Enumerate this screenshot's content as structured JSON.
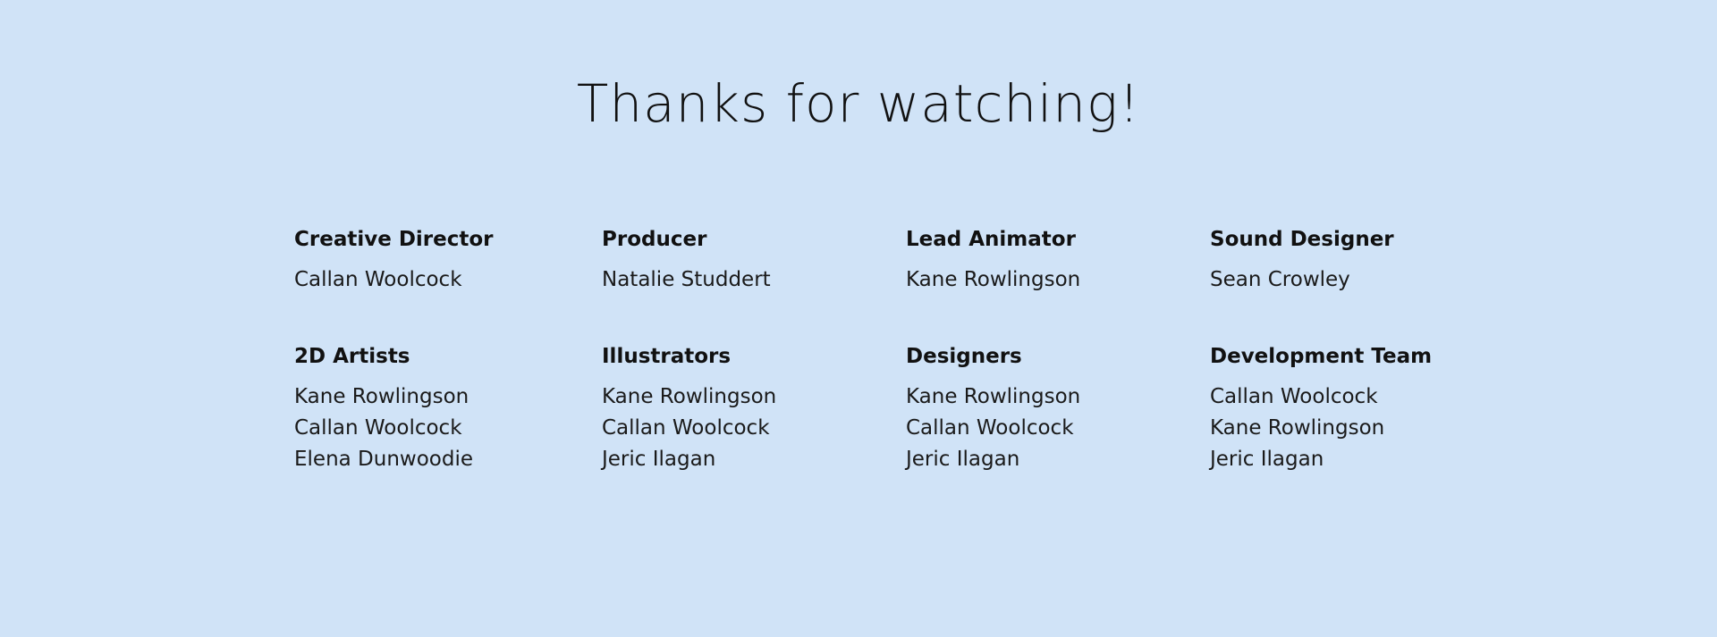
{
  "title": "Thanks for watching!",
  "credits": [
    {
      "role": "Creative Director",
      "names": [
        "Callan Woolcock"
      ]
    },
    {
      "role": "Producer",
      "names": [
        "Natalie Studdert"
      ]
    },
    {
      "role": "Lead Animator",
      "names": [
        "Kane Rowlingson"
      ]
    },
    {
      "role": "Sound Designer",
      "names": [
        "Sean Crowley"
      ]
    },
    {
      "role": "2D Artists",
      "names": [
        "Kane Rowlingson",
        "Callan Woolcock",
        "Elena Dunwoodie"
      ]
    },
    {
      "role": "Illustrators",
      "names": [
        "Kane Rowlingson",
        "Callan Woolcock",
        "Jeric Ilagan"
      ]
    },
    {
      "role": "Designers",
      "names": [
        "Kane Rowlingson",
        "Callan Woolcock",
        "Jeric Ilagan"
      ]
    },
    {
      "role": "Development Team",
      "names": [
        "Callan Woolcock",
        "Kane Rowlingson",
        "Jeric Ilagan"
      ]
    }
  ]
}
